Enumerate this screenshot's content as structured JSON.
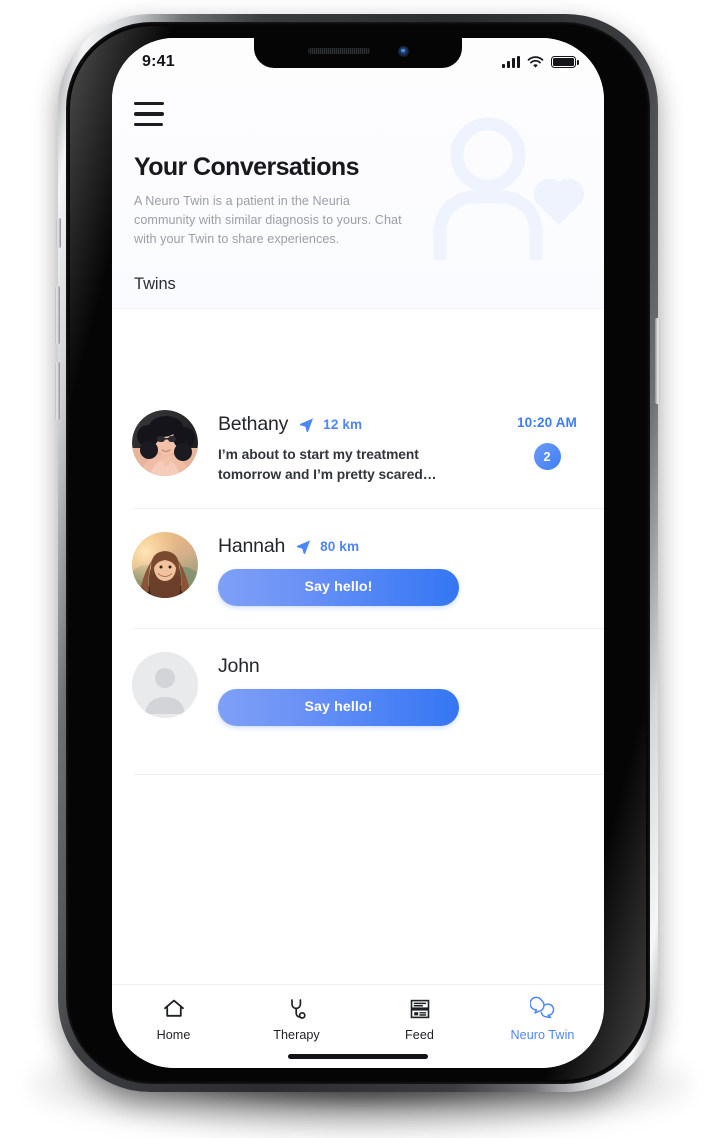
{
  "status_bar": {
    "time": "9:41",
    "signal_icon": "cellular-signal-icon",
    "wifi_icon": "wifi-icon",
    "battery_icon": "battery-full-icon"
  },
  "header": {
    "menu_icon": "hamburger-menu-icon",
    "title": "Your Conversations",
    "description": "A Neuro Twin is a patient in the Neuria community with similar diagnosis to yours. Chat with your Twin to share experiences.",
    "watermark_icon": "person-with-heart-icon",
    "watermark_color": "#eef3fd"
  },
  "section": {
    "label": "Twins"
  },
  "conversations": [
    {
      "name": "Bethany",
      "distance": "12 km",
      "distance_icon": "location-arrow-icon",
      "message": "I’m about to start my treatment tomorrow and I’m pretty scared…",
      "time": "10:20 AM",
      "unread_count": "2",
      "avatar_type": "photo-woman-sunglasses",
      "has_action_button": false
    },
    {
      "name": "Hannah",
      "distance": "80 km",
      "distance_icon": "location-arrow-icon",
      "message": "",
      "time": "",
      "unread_count": "",
      "avatar_type": "photo-woman-sunset",
      "has_action_button": true,
      "action_label": "Say hello!"
    },
    {
      "name": "John",
      "distance": "",
      "distance_icon": "",
      "message": "",
      "time": "",
      "unread_count": "",
      "avatar_type": "placeholder-person",
      "has_action_button": true,
      "action_label": "Say hello!"
    }
  ],
  "tabs": [
    {
      "label": "Home",
      "icon": "home-icon",
      "active": false
    },
    {
      "label": "Therapy",
      "icon": "stethoscope-icon",
      "active": false
    },
    {
      "label": "Feed",
      "icon": "article-list-icon",
      "active": false
    },
    {
      "label": "Neuro Twin",
      "icon": "chat-bubbles-icon",
      "active": true
    }
  ],
  "colors": {
    "accent": "#4f86f7",
    "accent_deep": "#3576f3",
    "text_primary": "#23262b",
    "text_muted": "#9a9ea6",
    "watermark": "#eef3fd"
  }
}
